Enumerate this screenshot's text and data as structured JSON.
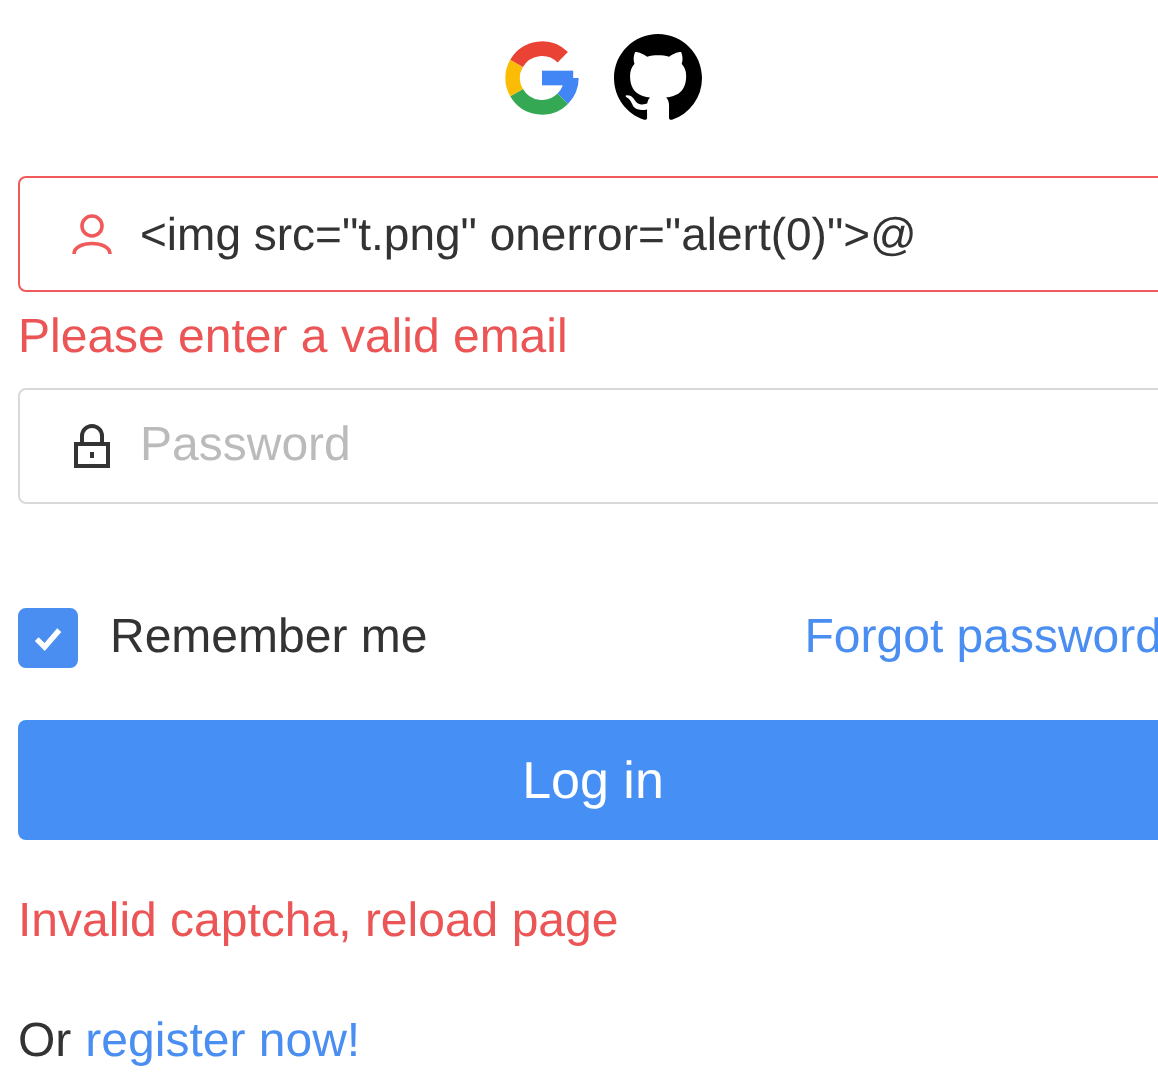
{
  "social_logins": [
    {
      "kind": "google"
    },
    {
      "kind": "github"
    }
  ],
  "email": {
    "value": "<img src=\"t.png\" onerror=\"alert(0)\">@",
    "invalid": true,
    "error": "Please enter a valid email"
  },
  "password": {
    "placeholder": "Password"
  },
  "remember": {
    "label": "Remember me",
    "checked": true
  },
  "forgot_link": "Forgot password",
  "login_button": "Log in",
  "form_error": "Invalid captcha, reload page",
  "register": {
    "prefix": "Or",
    "link": "register now!"
  }
}
